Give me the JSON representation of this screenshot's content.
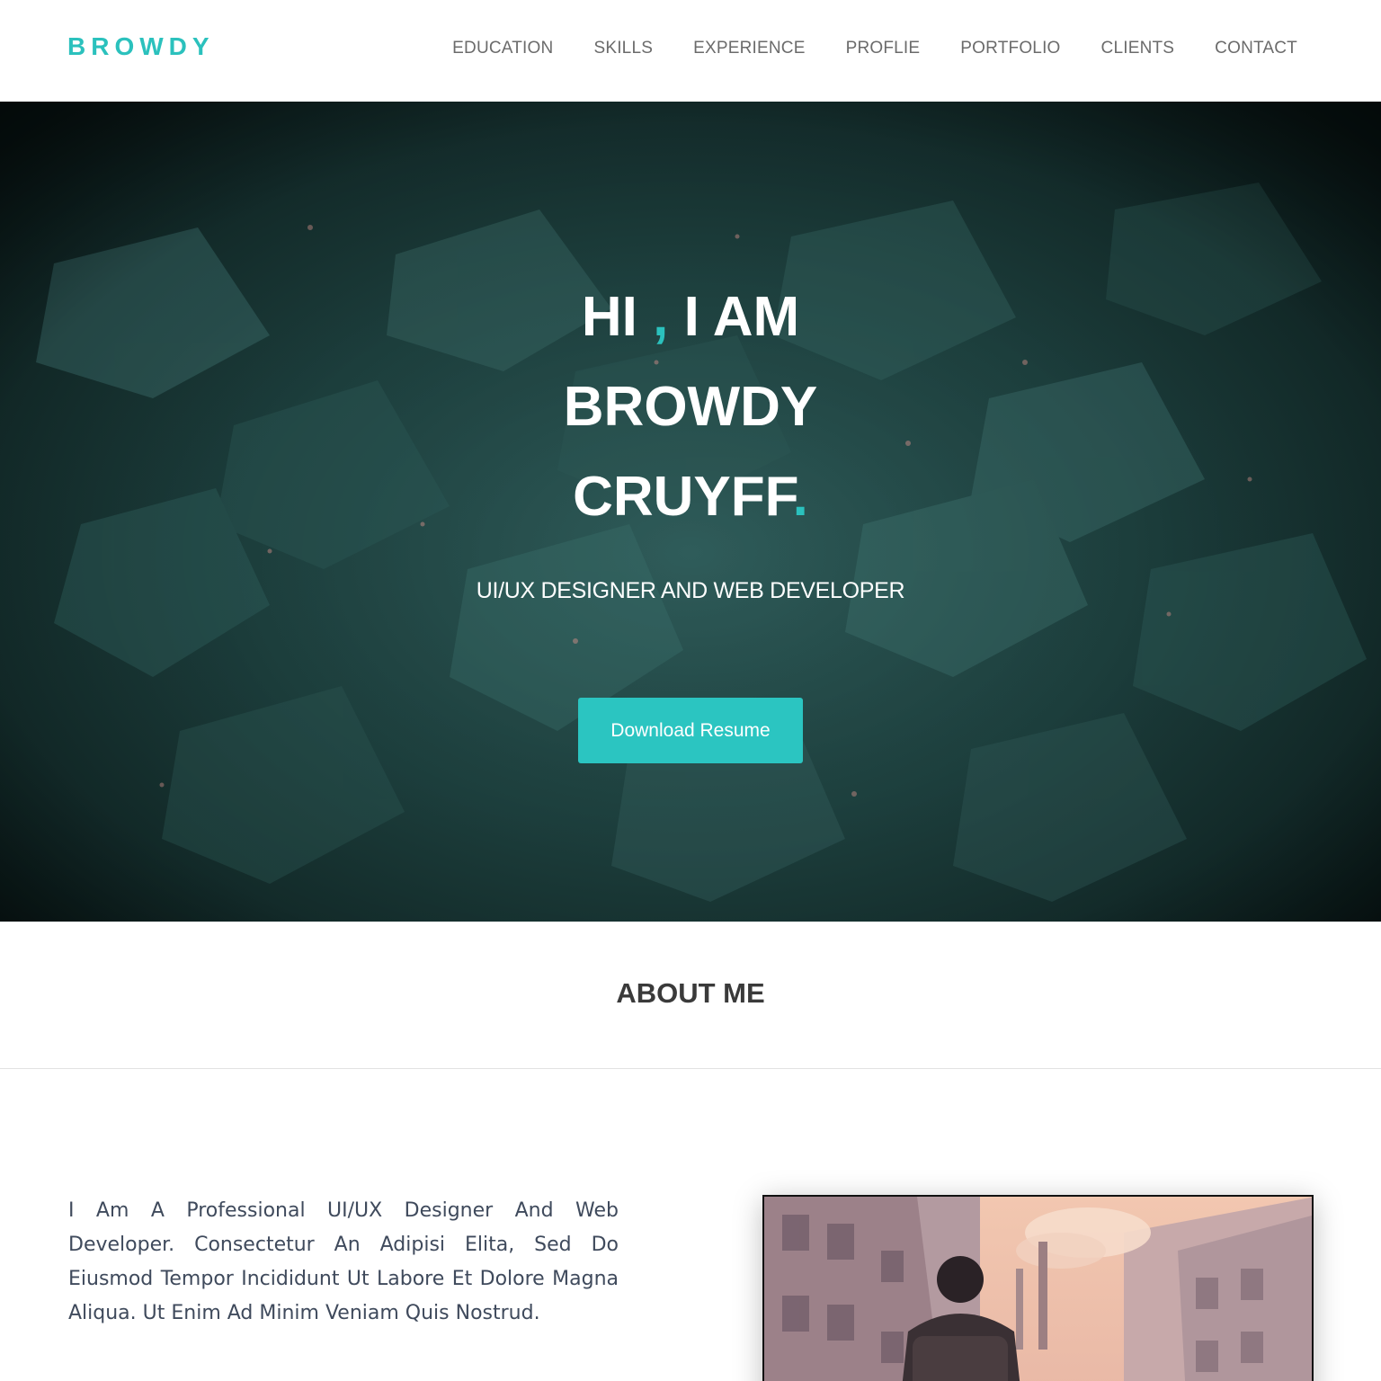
{
  "header": {
    "logo": "BROWDY",
    "nav": [
      "EDUCATION",
      "SKILLS",
      "EXPERIENCE",
      "PROFLIE",
      "PORTFOLIO",
      "CLIENTS",
      "CONTACT"
    ]
  },
  "hero": {
    "line1_a": "HI",
    "line1_comma": ",",
    "line1_b": "I AM",
    "line2": "BROWDY",
    "line3": "CRUYFF",
    "line3_dot": ".",
    "subtitle": "UI/UX DESIGNER AND WEB DEVELOPER",
    "button": "Download Resume"
  },
  "about": {
    "title": "ABOUT ME",
    "text": "I Am A Professional UI/UX Designer And Web Developer. Consectetur An Adipisi Elita, Sed Do Eiusmod Tempor Incididunt Ut Labore Et Dolore Magna Aliqua. Ut Enim Ad Minim Veniam Quis Nostrud."
  },
  "colors": {
    "accent": "#2bc1bd",
    "button": "#2bc5c1",
    "nav_text": "#6b6b6b",
    "hero_bg": "#1f4442"
  }
}
